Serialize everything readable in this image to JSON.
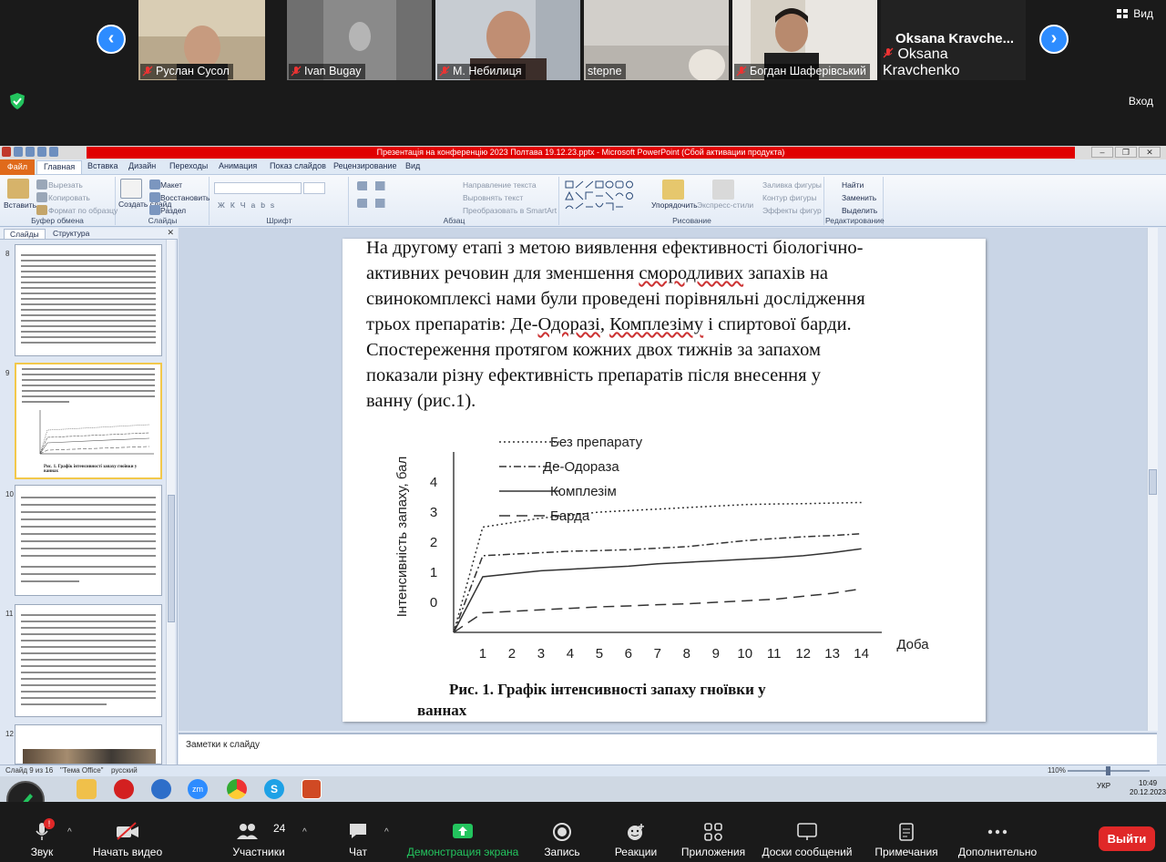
{
  "zoom": {
    "view_label": "Вид",
    "enter_label": "Вход",
    "participants": [
      {
        "name": "Руслан Сусол"
      },
      {
        "name": "Ivan Bugay"
      },
      {
        "name": "М. Небилиця"
      },
      {
        "name": "stepne"
      },
      {
        "name": "Богдан Шаферівський"
      },
      {
        "name": "Oksana Kravchenko",
        "display": "Oksana  Kravche..."
      }
    ],
    "toolbar": {
      "audio": "Звук",
      "video": "Начать видео",
      "participants": "Участники",
      "participants_count": "24",
      "chat": "Чат",
      "share": "Демонстрация экрана",
      "record": "Запись",
      "reactions": "Реакции",
      "apps": "Приложения",
      "whiteboards": "Доски сообщений",
      "notes": "Примечания",
      "more": "Дополнительно",
      "leave": "Выйти"
    },
    "audio_badge": "!"
  },
  "ppt": {
    "title": "Презентація на конференцію 2023  Полтава 19.12.23.pptx  -  Microsoft PowerPoint (Сбой активации продукта)",
    "tabs": [
      "Файл",
      "Главная",
      "Вставка",
      "Дизайн",
      "Переходы",
      "Анимация",
      "Показ слайдов",
      "Рецензирование",
      "Вид"
    ],
    "ribbon": {
      "clipboard": {
        "paste": "Вставить",
        "cut": "Вырезать",
        "copy": "Копировать",
        "format": "Формат по образцу",
        "group": "Буфер обмена"
      },
      "slides": {
        "new_slide": "Создать слайд",
        "layout": "Макет",
        "reset": "Восстановить",
        "section": "Раздел",
        "group": "Слайды"
      },
      "font": {
        "group": "Шрифт"
      },
      "paragraph": {
        "direction": "Направление текста",
        "align": "Выровнять текст",
        "smartart": "Преобразовать в SmartArt",
        "group": "Абзац"
      },
      "drawing": {
        "arrange": "Упорядочить",
        "styles": "Экспресс-стили",
        "fill": "Заливка фигуры",
        "outline": "Контур фигуры",
        "effects": "Эффекты фигур",
        "group": "Рисование"
      },
      "editing": {
        "find": "Найти",
        "replace": "Заменить",
        "select": "Выделить",
        "group": "Редактирование"
      }
    },
    "left_tabs": {
      "slides": "Слайды",
      "outline": "Структура"
    },
    "slide_numbers": [
      "8",
      "9",
      "10",
      "11",
      "12"
    ],
    "thumb9_caption": "Рис. 1. Графік інтенсивності  запаху  гноївки у ваннах",
    "notes_placeholder": "Заметки к слайду",
    "status": {
      "slide": "Слайд 9 из 16",
      "theme": "\"Тема Office\"",
      "lang": "русский",
      "zoom": "110%"
    }
  },
  "slide": {
    "lines": [
      "На другому етапі з метою виявлення   ефективності біологічно-",
      "активних   речовин для   зменшення смородливих   запахів на",
      "свинокомплексі нами були проведені порівняльні  дослідження",
      "трьох  препаратів:  Де-Одоразі, Комплезіму і спиртової барди.",
      "Спостереження протягом   кожних   двох   тижнів за запахом",
      "показали   різну   ефективність   препаратів після   внесення у",
      "ванну (рис.1)."
    ],
    "caption_line1": "Рис. 1. Графік інтенсивності   запаху   гноївки у",
    "caption_line2": "ваннах"
  },
  "chart_data": {
    "type": "line",
    "ylabel": "Інтенсивність запаху, бал",
    "xlabel": "Доба",
    "x": [
      0,
      1,
      2,
      3,
      4,
      5,
      6,
      7,
      8,
      9,
      10,
      11,
      12,
      13,
      14
    ],
    "x_ticks": [
      "1",
      "2",
      "3",
      "4",
      "5",
      "6",
      "7",
      "8",
      "9",
      "10",
      "11",
      "12",
      "13",
      "14"
    ],
    "y_ticks": [
      "0",
      "1",
      "2",
      "3",
      "4"
    ],
    "ylim": [
      -1,
      5
    ],
    "series": [
      {
        "name": "Без  препарату",
        "dash": "dotted",
        "values": [
          -1,
          2.5,
          2.65,
          2.8,
          2.9,
          3.0,
          3.05,
          3.1,
          3.15,
          3.2,
          3.25,
          3.27,
          3.28,
          3.3,
          3.32
        ]
      },
      {
        "name": "Де-Одораза",
        "dash": "dashdot",
        "values": [
          -1,
          1.55,
          1.6,
          1.65,
          1.7,
          1.72,
          1.75,
          1.8,
          1.85,
          1.95,
          2.05,
          2.12,
          2.18,
          2.22,
          2.28
        ]
      },
      {
        "name": "Комплезім",
        "dash": "solid",
        "values": [
          -1,
          0.85,
          0.95,
          1.05,
          1.1,
          1.15,
          1.2,
          1.28,
          1.33,
          1.38,
          1.43,
          1.48,
          1.55,
          1.65,
          1.78
        ]
      },
      {
        "name": "Барда",
        "dash": "dashed",
        "values": [
          -1,
          -0.35,
          -0.3,
          -0.25,
          -0.2,
          -0.15,
          -0.12,
          -0.08,
          -0.05,
          0.0,
          0.05,
          0.1,
          0.2,
          0.3,
          0.45
        ]
      }
    ],
    "legend_position": "top"
  },
  "taskbar": {
    "lang": "УКР",
    "time": "10:49",
    "date": "20.12.2023"
  }
}
